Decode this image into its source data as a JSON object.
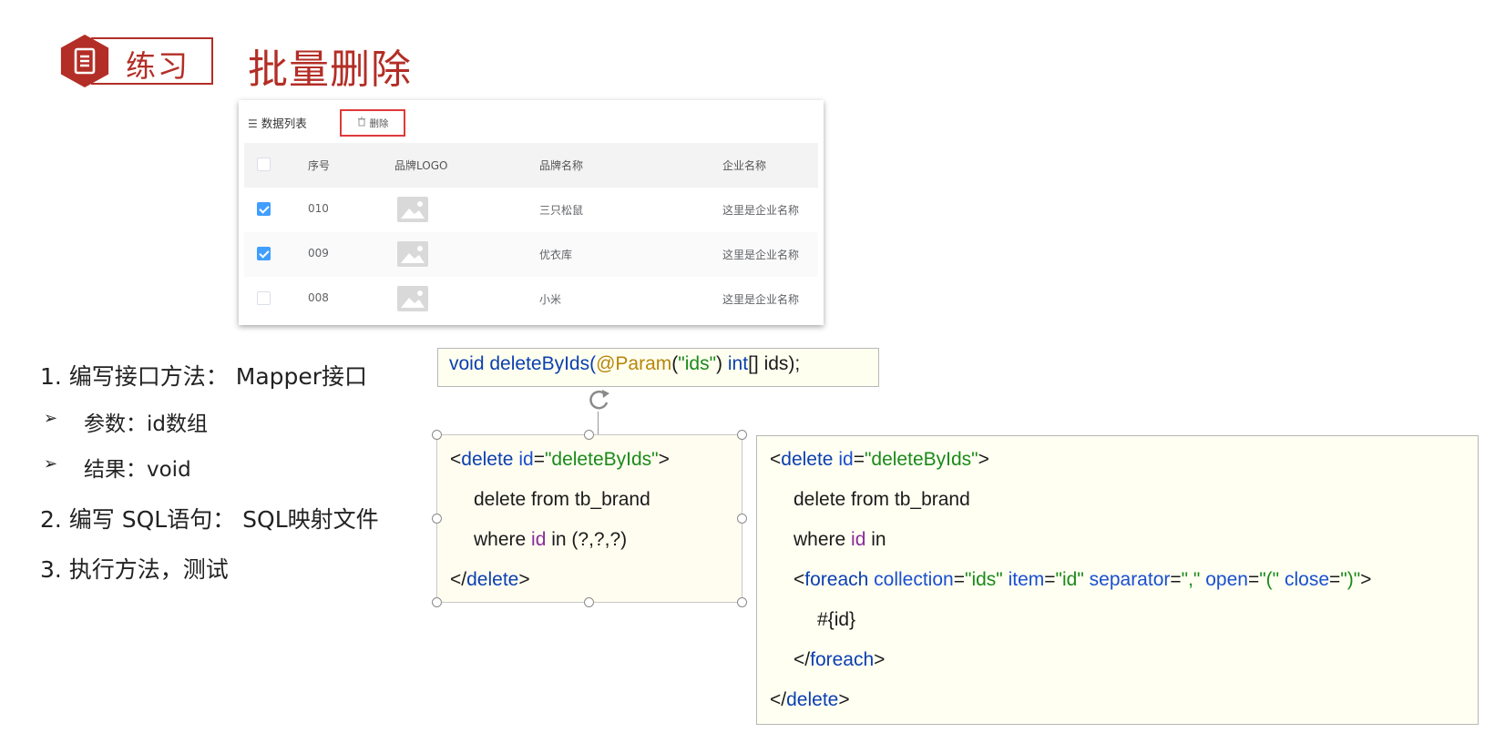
{
  "slide": {
    "badge_label": "练习",
    "title": "批量删除",
    "badge_icon": "document-icon",
    "accent_color": "#b32e26"
  },
  "table": {
    "list_label": "数据列表",
    "list_icon": "list-icon",
    "delete_button": "删除",
    "delete_icon": "trash-icon",
    "columns": [
      "序号",
      "品牌LOGO",
      "品牌名称",
      "企业名称"
    ],
    "rows": [
      {
        "id": "010",
        "brand": "三只松鼠",
        "company": "这里是企业名称",
        "checked": true
      },
      {
        "id": "009",
        "brand": "优衣库",
        "company": "这里是企业名称",
        "checked": true
      },
      {
        "id": "008",
        "brand": "小米",
        "company": "这里是企业名称",
        "checked": false
      }
    ],
    "checkbox_color": "#409eff"
  },
  "steps": {
    "s1": "1.  编写接口方法：  Mapper接口",
    "s1a": "参数：id数组",
    "s1b": "结果：void",
    "s2": "2.  编写 SQL语句：  SQL映射文件",
    "s3": "3.  执行方法，测试",
    "bullet": "➢"
  },
  "code": {
    "sig_void": "void",
    "sig_method": "deleteByIds(",
    "sig_anno": "@Param",
    "sig_str": "\"ids\"",
    "sig_int": "int",
    "sig_rest": "[] ids);",
    "lt": "<",
    "delete_tag": "delete",
    "id_attr": "id",
    "eq": "=",
    "id_val": "\"deleteByIds\"",
    "gt": ">",
    "line_delete": "delete from tb_brand",
    "where": "where",
    "id_word": "id",
    "in": "in",
    "in_list": "in (?,?,?)",
    "close_delete": "</",
    "foreach_tag": "foreach",
    "collection_attr": "collection",
    "collection_val": "\"ids\"",
    "item_attr": "item",
    "item_val": "\"id\"",
    "separator_attr": "separator",
    "separator_val": "\",\"",
    "open_attr": "open",
    "open_val": "\"(\"",
    "close_attr": "close",
    "close_val": "\")\"",
    "placeholder": "#{id}"
  }
}
